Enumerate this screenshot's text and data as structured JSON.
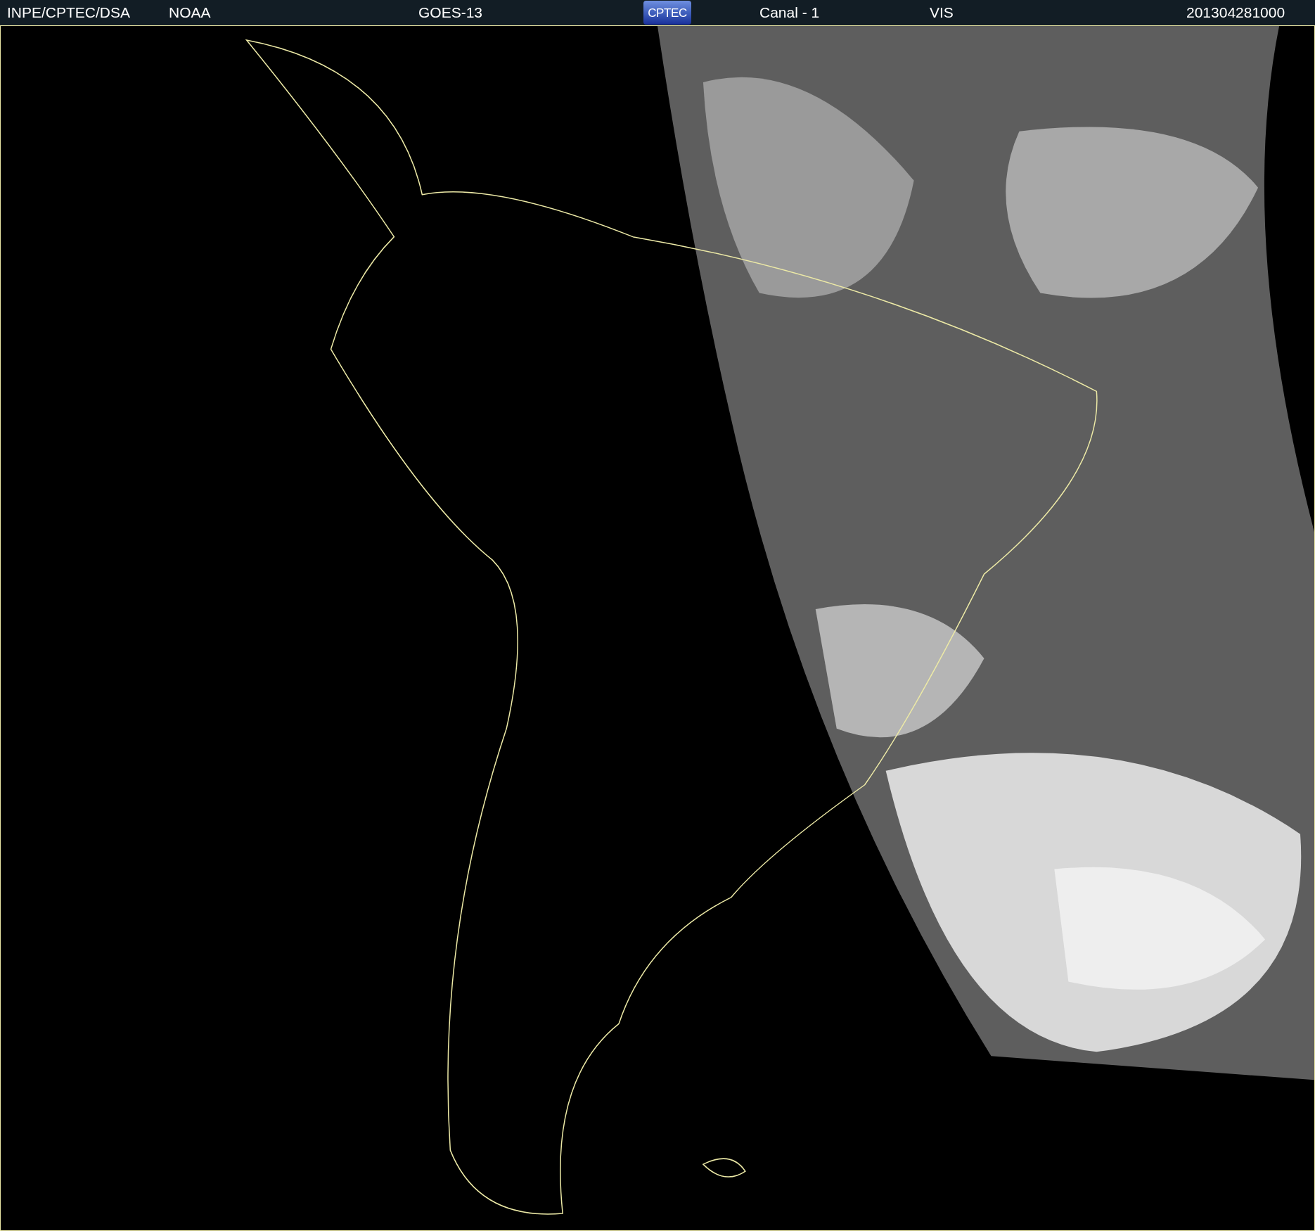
{
  "header": {
    "source": "INPE/CPTEC/DSA",
    "agency": "NOAA",
    "satellite": "GOES-13",
    "logo": "CPTEC",
    "channel": "Canal - 1",
    "band": "VIS",
    "timestamp": "201304281000"
  }
}
